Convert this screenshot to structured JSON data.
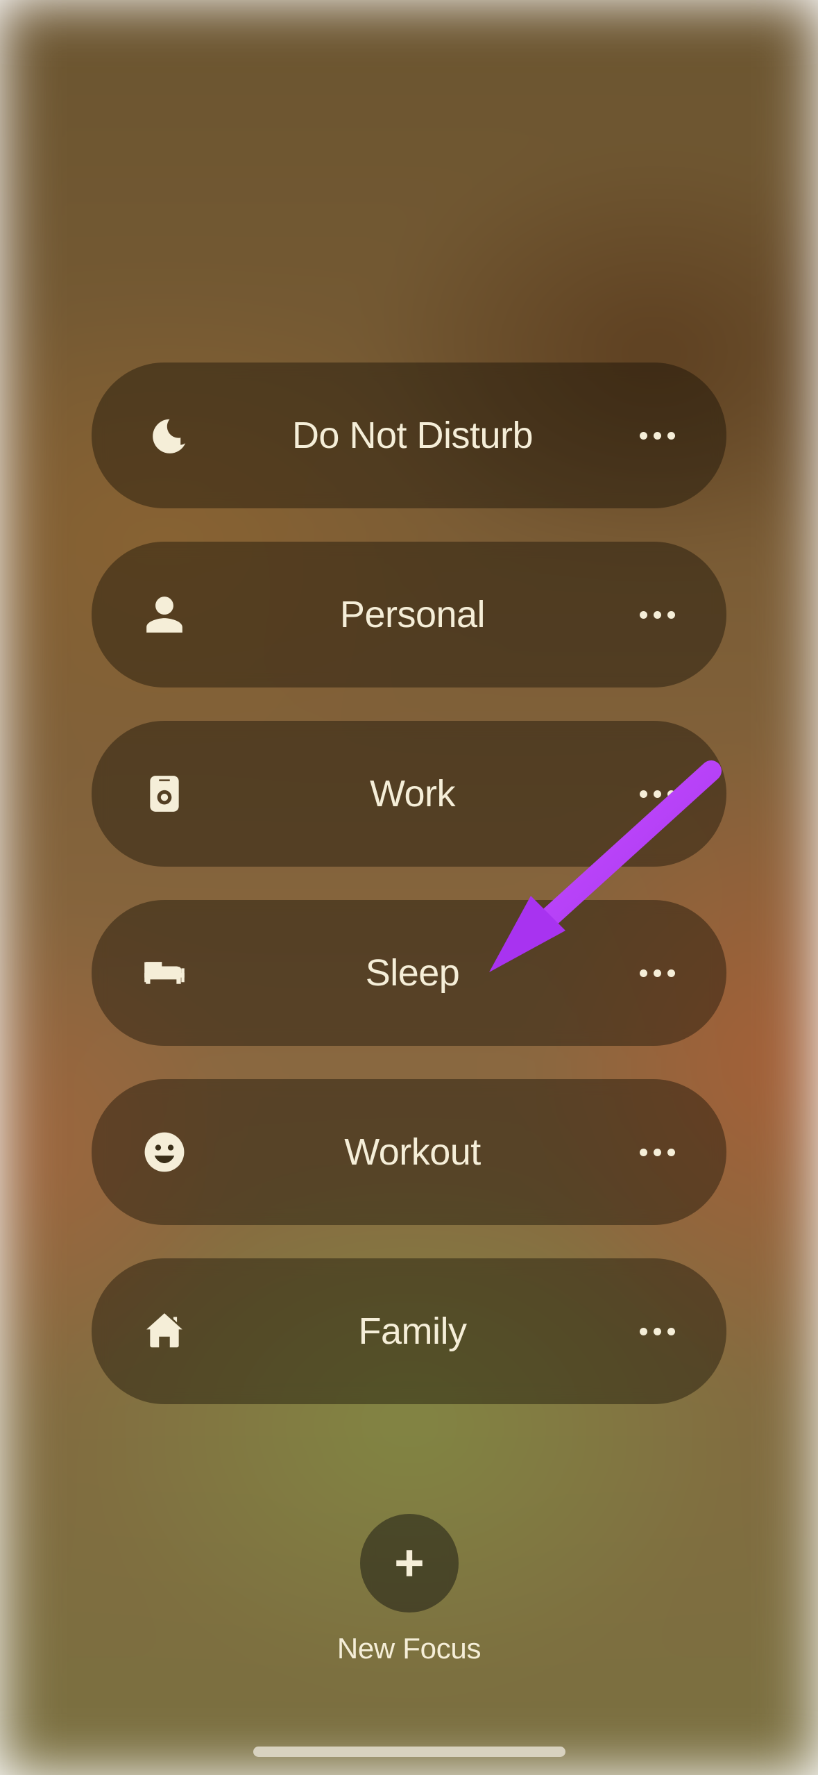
{
  "focus_modes": [
    {
      "id": "dnd",
      "label": "Do Not Disturb",
      "icon": "moon"
    },
    {
      "id": "personal",
      "label": "Personal",
      "icon": "person"
    },
    {
      "id": "work",
      "label": "Work",
      "icon": "badge"
    },
    {
      "id": "sleep",
      "label": "Sleep",
      "icon": "bed"
    },
    {
      "id": "workout",
      "label": "Workout",
      "icon": "smile"
    },
    {
      "id": "family",
      "label": "Family",
      "icon": "house"
    }
  ],
  "new_focus": {
    "label": "New Focus"
  },
  "annotation": {
    "type": "arrow",
    "color": "#b845f5",
    "target": "sleep"
  }
}
